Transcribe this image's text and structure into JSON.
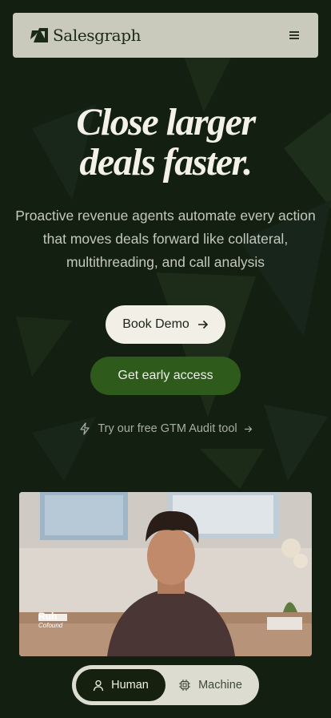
{
  "header": {
    "brand_name": "Salesgraph",
    "logo_icon": "salesgraph-logo-icon",
    "menu_icon": "hamburger-menu-icon"
  },
  "hero": {
    "title_line1": "Close larger",
    "title_line2": "deals faster.",
    "subtitle": "Proactive revenue agents automate every action that moves deals forward like collateral, multithreading, and call analysis"
  },
  "cta": {
    "book_demo_label": "Book Demo",
    "book_demo_icon": "arrow-right-icon",
    "early_access_label": "Get early access"
  },
  "audit": {
    "label": "Try our free GTM Audit tool",
    "bolt_icon": "lightning-bolt-icon",
    "arrow_icon": "arrow-right-icon"
  },
  "video": {
    "overlay_line1": "Ruh",
    "overlay_line2": "Cofound"
  },
  "toggle": {
    "human_label": "Human",
    "machine_label": "Machine",
    "human_icon": "person-icon",
    "machine_icon": "chip-icon"
  },
  "colors": {
    "background": "#132011",
    "header_bg": "#c9cabb",
    "primary_green": "#2e5a1c",
    "demo_button": "#f1efe6"
  }
}
